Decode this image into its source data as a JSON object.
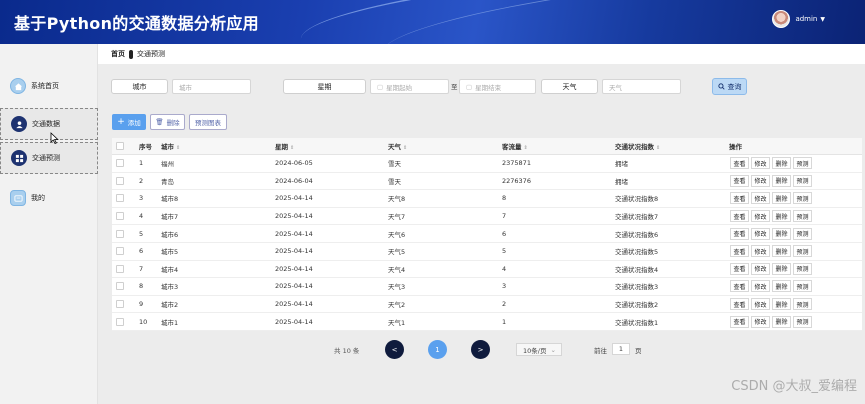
{
  "app": {
    "title": "基于Python的交通数据分析应用"
  },
  "user": {
    "name": "admin",
    "caret": "▼"
  },
  "sidebar": {
    "items": [
      {
        "label": "系统首页",
        "icon": "home-icon"
      },
      {
        "label": "交通数据",
        "icon": "user-icon"
      },
      {
        "label": "交通预测",
        "icon": "grid-icon"
      },
      {
        "label": "我的",
        "icon": "profile-card-icon"
      }
    ]
  },
  "breadcrumb": {
    "home": "首页",
    "current": "交通预测"
  },
  "search": {
    "city_label": "城市",
    "city_placeholder": "城市",
    "week_label": "星期",
    "week_start_placeholder": "星期起始",
    "range_sep": "至",
    "week_end_placeholder": "星期结束",
    "weather_label": "天气",
    "weather_placeholder": "天气",
    "query_label": "查询"
  },
  "toolbar": {
    "add_label": "添加",
    "delete_label": "删除",
    "chart_label": "预测图表"
  },
  "table": {
    "headers": [
      "序号",
      "城市",
      "星期",
      "天气",
      "客流量",
      "交通状况指数",
      "操作"
    ],
    "ops": [
      "查看",
      "修改",
      "删除",
      "预测"
    ],
    "rows": [
      [
        "1",
        "福州",
        "2024-06-05",
        "雪天",
        "2375871",
        "拥堵"
      ],
      [
        "2",
        "青岛",
        "2024-06-04",
        "雪天",
        "2276376",
        "拥堵"
      ],
      [
        "3",
        "城市8",
        "2025-04-14",
        "天气8",
        "8",
        "交通状况指数8"
      ],
      [
        "4",
        "城市7",
        "2025-04-14",
        "天气7",
        "7",
        "交通状况指数7"
      ],
      [
        "5",
        "城市6",
        "2025-04-14",
        "天气6",
        "6",
        "交通状况指数6"
      ],
      [
        "6",
        "城市5",
        "2025-04-14",
        "天气5",
        "5",
        "交通状况指数5"
      ],
      [
        "7",
        "城市4",
        "2025-04-14",
        "天气4",
        "4",
        "交通状况指数4"
      ],
      [
        "8",
        "城市3",
        "2025-04-14",
        "天气3",
        "3",
        "交通状况指数3"
      ],
      [
        "9",
        "城市2",
        "2025-04-14",
        "天气2",
        "2",
        "交通状况指数2"
      ],
      [
        "10",
        "城市1",
        "2025-04-14",
        "天气1",
        "1",
        "交通状况指数1"
      ]
    ]
  },
  "pager": {
    "total": "共 10 条",
    "prev": "<",
    "current": "1",
    "next": ">",
    "page_size": "10条/页",
    "goto_label": "前往",
    "goto_value": "1",
    "goto_suffix": "页"
  },
  "watermark": "CSDN @大叔_爱编程"
}
